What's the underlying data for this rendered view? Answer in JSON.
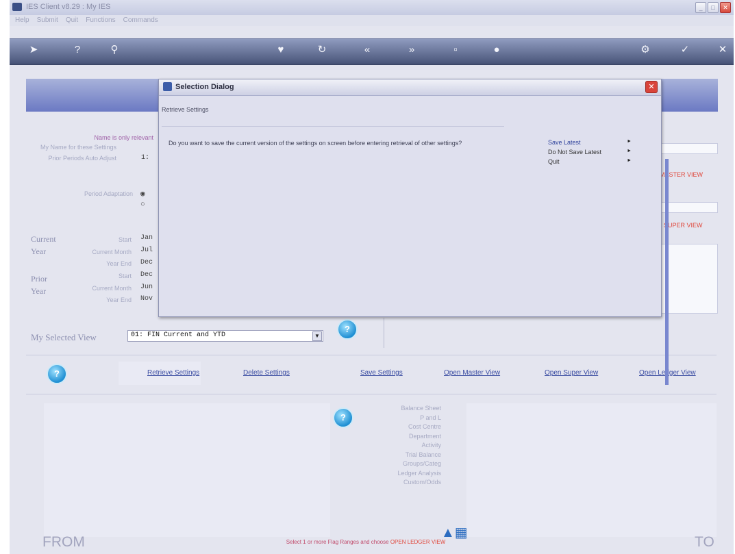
{
  "window": {
    "title": "IES Client v8.29 : My IES"
  },
  "menu": [
    "Help",
    "Submit",
    "Quit",
    "Functions",
    "Commands"
  ],
  "toolbar_icons": [
    "arrow-right-icon",
    "help-icon",
    "search-icon",
    "heart-icon",
    "refresh-icon",
    "back-icon",
    "forward-icon",
    "stop-icon",
    "circle-icon",
    "gear-icon",
    "check-icon",
    "close-icon"
  ],
  "form": {
    "note": "Name is only relevant",
    "name_label": "My Name for these Settings",
    "prior_label": "Prior Periods Auto Adjust",
    "prior_value": "1:",
    "period_label": "Period Adaptation",
    "current": "Current",
    "prior": "Prior",
    "year": "Year",
    "start_label": "Start",
    "current_month_label": "Current Month",
    "year_end_label": "Year End",
    "cur_start": "Jan",
    "cur_month": "Jul",
    "cur_end": "Dec",
    "prior_start": "Dec",
    "prior_month": "Jun",
    "prior_end": "Nov",
    "master_link": "EN MASTER VIEW",
    "super_link": "PEN SUPER VIEW",
    "my_view_label": "My Selected View",
    "my_view_value": "01: FIN Current and YTD"
  },
  "actions": [
    "Retrieve Settings",
    "Delete Settings",
    "Save Settings",
    "Open Master View",
    "Open Super View",
    "Open Ledger View"
  ],
  "flags": [
    "Balance Sheet",
    "P and L",
    "Cost Centre",
    "Department",
    "Activity",
    "Trial Balance",
    "Groups/Categ",
    "Ledger Analysis",
    "Custom/Odds"
  ],
  "footer": {
    "from": "FROM",
    "to": "TO",
    "note_prefix": "Select 1 or more Flag Ranges and choose",
    "note_link": "OPEN LEDGER VIEW"
  },
  "dialog": {
    "title": "Selection Dialog",
    "subtitle": "Retrieve Settings",
    "question": "Do you want to save the current version of the settings on screen before entering retrieval of other settings?",
    "options": [
      "Save Latest",
      "Do Not Save Latest",
      "Quit"
    ]
  },
  "colors": {
    "banner": "#7f8bcc",
    "toolbar": "#5c6891",
    "link_red": "#e0463a",
    "link_blue": "#3a4ca2"
  }
}
